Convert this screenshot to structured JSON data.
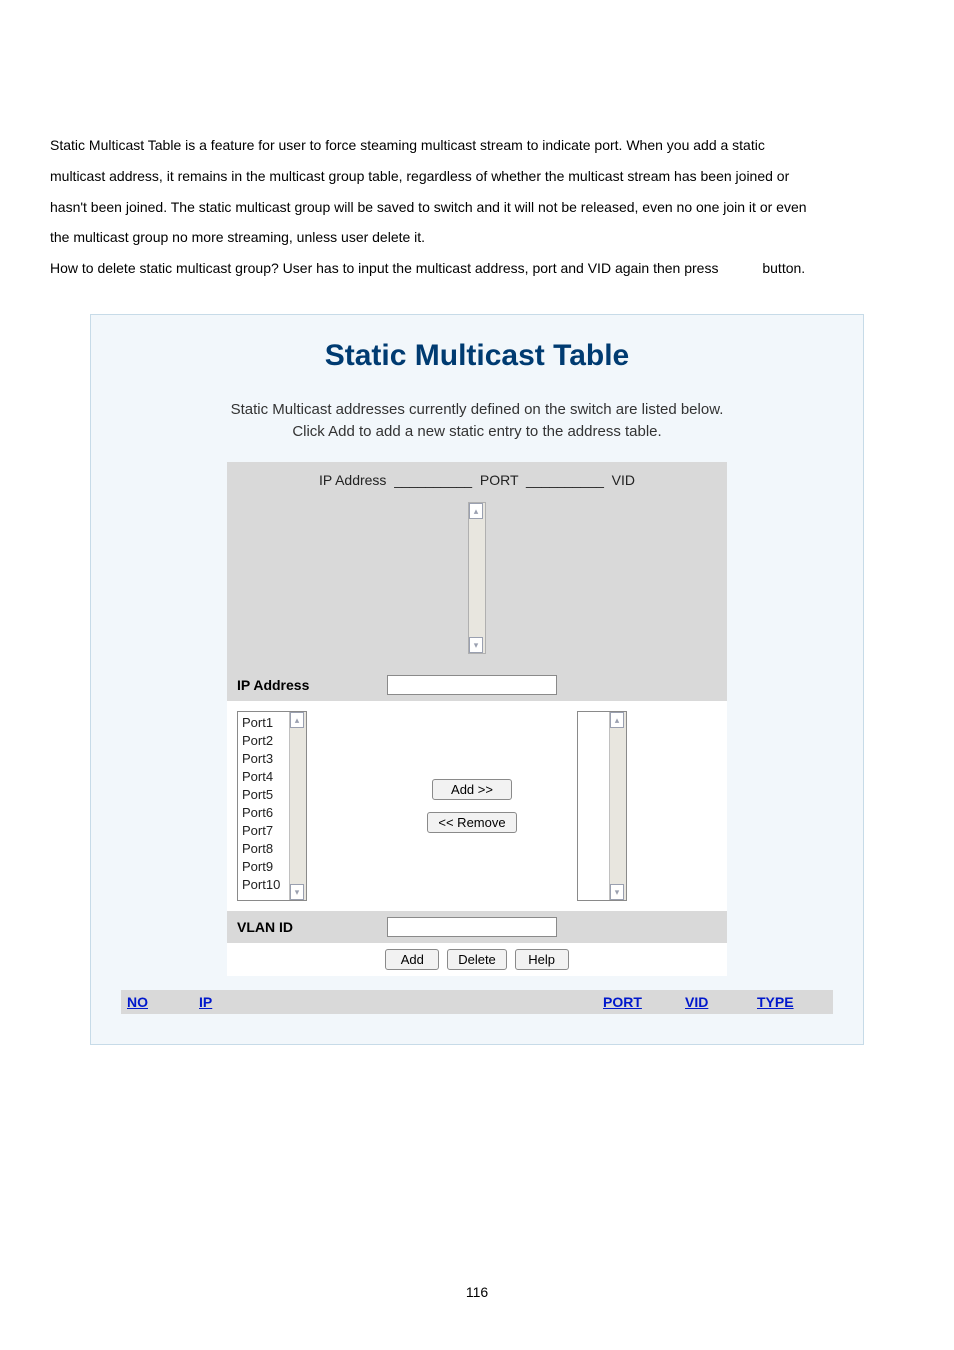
{
  "paragraph": {
    "p1": "Static Multicast Table is a feature for user to force steaming multicast stream to indicate port. When you add a static",
    "p2": "multicast address, it remains in the multicast group table, regardless of whether the multicast stream has been joined or",
    "p3": "hasn't been joined. The static multicast group will be saved to switch and it will not be released, even no one join it or even",
    "p4": "the multicast group no more streaming, unless user delete it.",
    "p5a": "How to delete static multicast group? User has to input the multicast address, port and VID again then press",
    "p5b": "button."
  },
  "panel": {
    "title": "Static Multicast Table",
    "desc1": "Static Multicast addresses currently defined on the switch are listed below.",
    "desc2": "Click Add to add a new static entry to the address table.",
    "hdr_ip": "IP Address",
    "hdr_port": "PORT",
    "hdr_vid": "VID",
    "row_ip_label": "IP Address",
    "row_vlan_label": "VLAN ID",
    "ports": [
      "Port1",
      "Port2",
      "Port3",
      "Port4",
      "Port5",
      "Port6",
      "Port7",
      "Port8",
      "Port9",
      "Port10"
    ],
    "btn_add_move": "Add   >>",
    "btn_remove_move": "<< Remove",
    "btn_add": "Add",
    "btn_delete": "Delete",
    "btn_help": "Help"
  },
  "result_headers": {
    "no": "NO",
    "ip": "IP",
    "port": "PORT",
    "vid": "VID",
    "type": "TYPE"
  },
  "page_number": "116"
}
